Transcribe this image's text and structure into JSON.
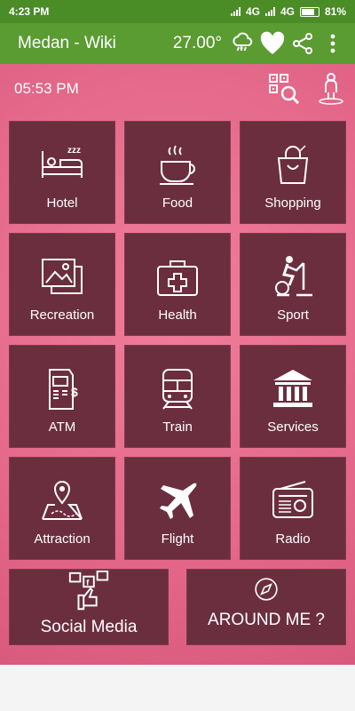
{
  "status_bar": {
    "time": "4:23 PM",
    "network_1": "4G",
    "network_2": "4G",
    "battery": "81%"
  },
  "toolbar": {
    "title": "Medan - Wiki",
    "temperature": "27.00°",
    "icons": [
      "weather-rain-icon",
      "heart-icon",
      "share-icon",
      "more-vert-icon"
    ]
  },
  "header": {
    "clock": "05:53 PM",
    "icons": [
      "qr-search-icon",
      "person-icon"
    ]
  },
  "tiles": [
    {
      "label": "Hotel",
      "icon": "bed-icon"
    },
    {
      "label": "Food",
      "icon": "coffee-cup-icon"
    },
    {
      "label": "Shopping",
      "icon": "shopping-bag-icon"
    },
    {
      "label": "Recreation",
      "icon": "picture-icon"
    },
    {
      "label": "Health",
      "icon": "first-aid-kit-icon"
    },
    {
      "label": "Sport",
      "icon": "exercise-bike-icon"
    },
    {
      "label": "ATM",
      "icon": "atm-icon"
    },
    {
      "label": "Train",
      "icon": "train-icon"
    },
    {
      "label": "Services",
      "icon": "bank-icon"
    },
    {
      "label": "Attraction",
      "icon": "map-pin-icon"
    },
    {
      "label": "Flight",
      "icon": "airplane-icon"
    },
    {
      "label": "Radio",
      "icon": "radio-icon"
    }
  ],
  "wide_tiles": [
    {
      "label": "Social Media",
      "icon": "social-media-icon"
    },
    {
      "label": "AROUND ME ?",
      "icon": "compass-icon"
    }
  ],
  "colors": {
    "status_bar": "#4a8c25",
    "toolbar": "#5a9b32",
    "background": "#e86b8a",
    "tile": "#6b2e3f"
  }
}
